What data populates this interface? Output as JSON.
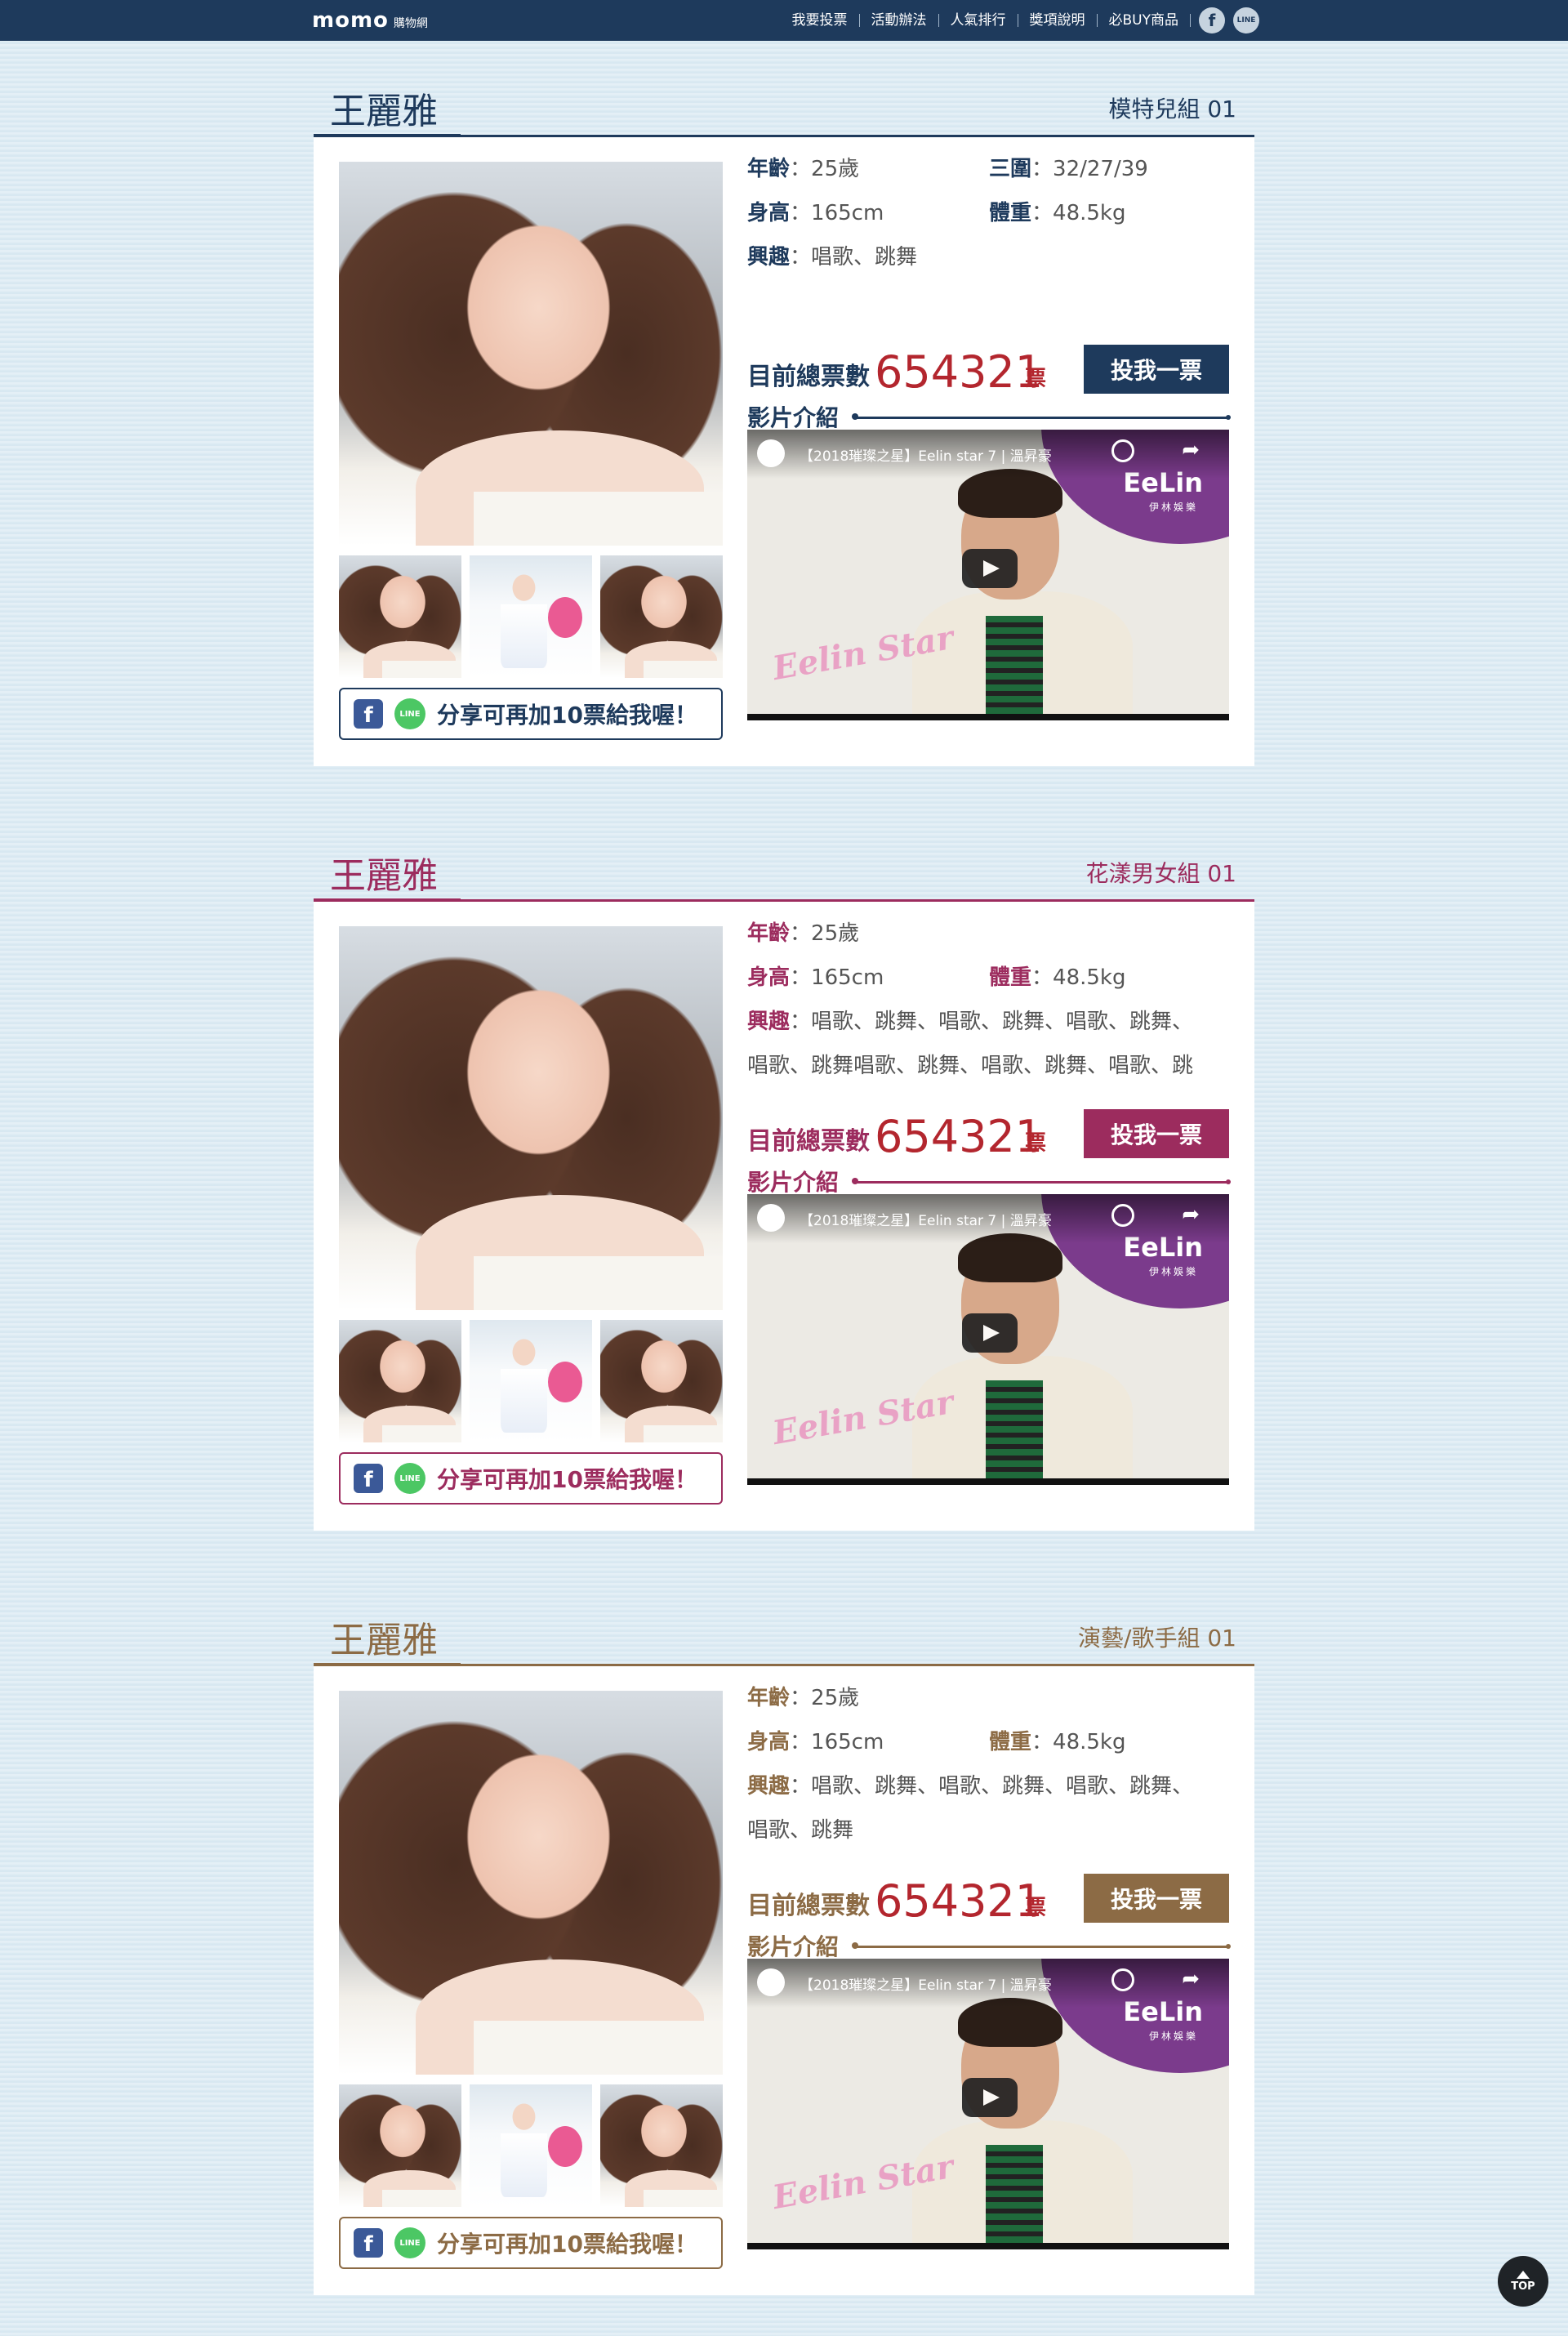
{
  "header": {
    "logo": "momo",
    "logo_sub": "購物網",
    "nav": [
      "我要投票",
      "活動辦法",
      "人氣排行",
      "獎項說明",
      "必BUY商品"
    ],
    "social": [
      {
        "icon": "facebook-icon",
        "glyph": "f"
      },
      {
        "icon": "line-icon",
        "glyph": "LINE"
      }
    ]
  },
  "sections": [
    {
      "theme": "#1e3a5c",
      "name": "王麗雅",
      "group": "模特兒組 01",
      "age_label": "年齡",
      "age_sep": "：",
      "age": "25歲",
      "measure_label": "三圍",
      "measure": "32/27/39",
      "height_label": "身高",
      "height": "165cm",
      "weight_label": "體重",
      "weight": "48.5kg",
      "hobby_label": "興趣",
      "hobby_line1": "唱歌、跳舞",
      "hobby_line2": "",
      "votes_label": "目前總票數",
      "votes": "654321",
      "votes_unit": "票",
      "vote_button": "投我一票",
      "video_label": "影片介紹",
      "video_title": "【2018璀璨之星】Eelin star 7 | 溫昇豪",
      "video_brand": "EeLin",
      "video_brand_sub": "伊林娛樂",
      "video_script": "Eelin Star",
      "share_fb": "f",
      "share_line": "LINE",
      "share_text": "分享可再加10票給我喔！"
    },
    {
      "theme": "#9c2c5e",
      "name": "王麗雅",
      "group": "花漾男女組 01",
      "age_label": "年齡",
      "age_sep": "：",
      "age": "25歲",
      "measure_label": "",
      "measure": "",
      "height_label": "身高",
      "height": "165cm",
      "weight_label": "體重",
      "weight": "48.5kg",
      "hobby_label": "興趣",
      "hobby_line1": "唱歌、跳舞、唱歌、跳舞、唱歌、跳舞、",
      "hobby_line2": "唱歌、跳舞唱歌、跳舞、唱歌、跳舞、唱歌、跳",
      "votes_label": "目前總票數",
      "votes": "654321",
      "votes_unit": "票",
      "vote_button": "投我一票",
      "video_label": "影片介紹",
      "video_title": "【2018璀璨之星】Eelin star 7 | 溫昇豪",
      "video_brand": "EeLin",
      "video_brand_sub": "伊林娛樂",
      "video_script": "Eelin Star",
      "share_fb": "f",
      "share_line": "LINE",
      "share_text": "分享可再加10票給我喔！"
    },
    {
      "theme": "#8c6b45",
      "name": "王麗雅",
      "group": "演藝/歌手組 01",
      "age_label": "年齡",
      "age_sep": "：",
      "age": "25歲",
      "measure_label": "",
      "measure": "",
      "height_label": "身高",
      "height": "165cm",
      "weight_label": "體重",
      "weight": "48.5kg",
      "hobby_label": "興趣",
      "hobby_line1": "唱歌、跳舞、唱歌、跳舞、唱歌、跳舞、",
      "hobby_line2": "唱歌、跳舞",
      "votes_label": "目前總票數",
      "votes": "654321",
      "votes_unit": "票",
      "vote_button": "投我一票",
      "video_label": "影片介紹",
      "video_title": "【2018璀璨之星】Eelin star 7 | 溫昇豪",
      "video_brand": "EeLin",
      "video_brand_sub": "伊林娛樂",
      "video_script": "Eelin Star",
      "share_fb": "f",
      "share_line": "LINE",
      "share_text": "分享可再加10票給我喔！"
    }
  ],
  "top_button": "TOP"
}
